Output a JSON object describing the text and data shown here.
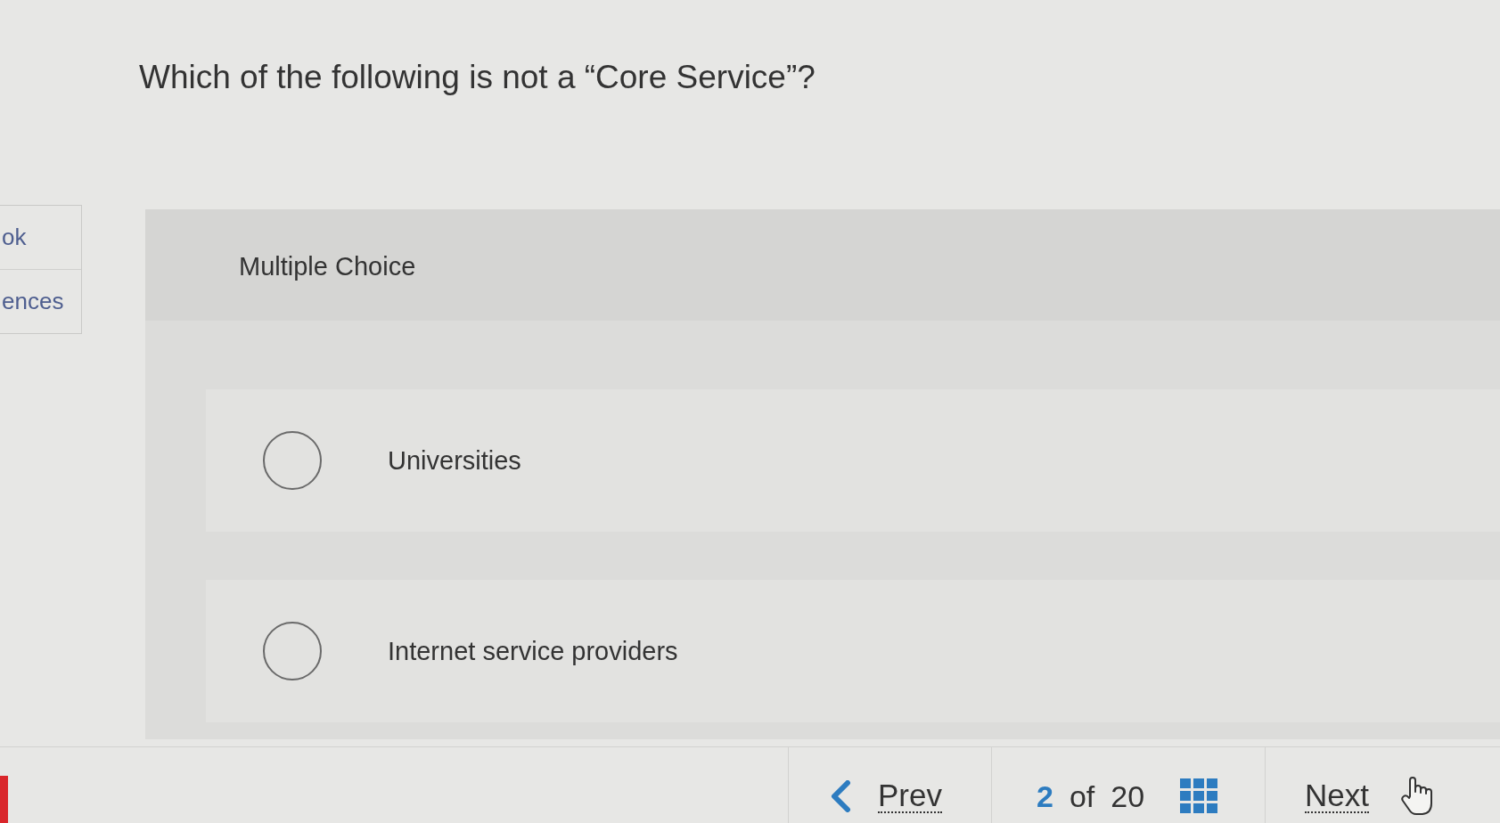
{
  "question": {
    "text": "Which of the following is not a “Core Service”?"
  },
  "sidebar": {
    "items": [
      {
        "label": "ok"
      },
      {
        "label": "ences"
      }
    ]
  },
  "answer_panel": {
    "type_label": "Multiple Choice",
    "options": [
      {
        "label": "Universities",
        "selected": false
      },
      {
        "label": "Internet service providers",
        "selected": false
      }
    ]
  },
  "pagination": {
    "prev": "Prev",
    "current": "2",
    "separator": "of",
    "total": "20",
    "next": "Next"
  }
}
